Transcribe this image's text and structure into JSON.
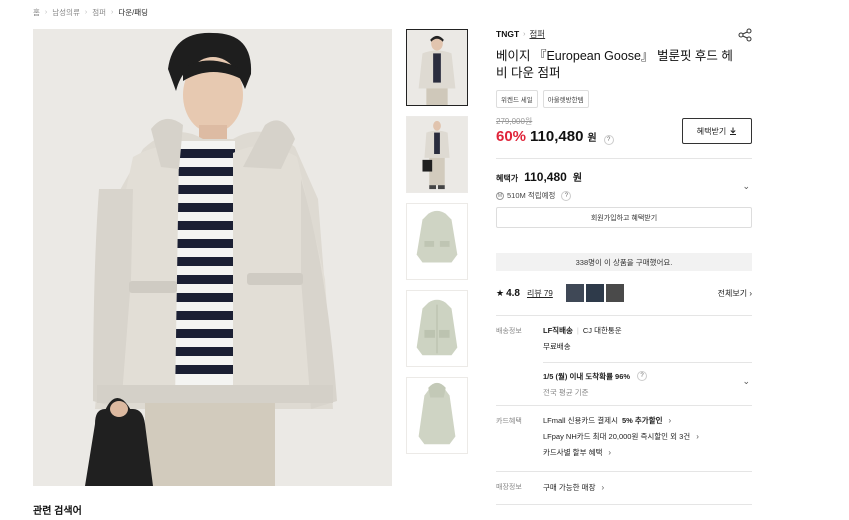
{
  "breadcrumb": [
    "홈",
    "남성의류",
    "점퍼",
    "다운/패딩"
  ],
  "related_title": "관련 검색어",
  "product": {
    "brand": "TNGT",
    "category": "점퍼",
    "title": "베이지 『European Goose』 벌룬핏 후드 헤비 다운 점퍼",
    "tags": [
      "위켄드 세일",
      "아울렛방한템"
    ],
    "original_price": "279,000원",
    "discount": "60%",
    "price": "110,480",
    "currency": "원",
    "coupon_button": "혜택받기"
  },
  "benefit": {
    "label": "혜택가",
    "price": "110,480",
    "currency": "원",
    "points": "510M 적립예정",
    "member_button": "회원가입하고 혜택받기"
  },
  "buyers_text": "338명이 이 상품을 구매했어요.",
  "review": {
    "rating": "4.8",
    "count_label": "리뷰 79",
    "see_all": "전체보기"
  },
  "shipping": {
    "label": "배송정보",
    "carrier_main": "LF직배송",
    "carrier_sub": "CJ 대한통운",
    "fee": "무료배송",
    "eta": "1/5 (월) 이내 도착확률 96%",
    "eta_sub": "전국 평균 기준"
  },
  "card": {
    "label": "카드혜택",
    "line1_pre": "LFmall 신용카드 결제시",
    "line1_bold": "5% 추가할인",
    "line2": "LFpay NH카드 최대 20,000원 즉시할인 외 3건",
    "line3": "카드사별 할부 혜택"
  },
  "store": {
    "label": "매장정보",
    "text": "구매 가능한 매장"
  },
  "colors": {
    "discount": "#e0243a",
    "jacket": "#dedad2",
    "background": "#e9e7e3"
  }
}
